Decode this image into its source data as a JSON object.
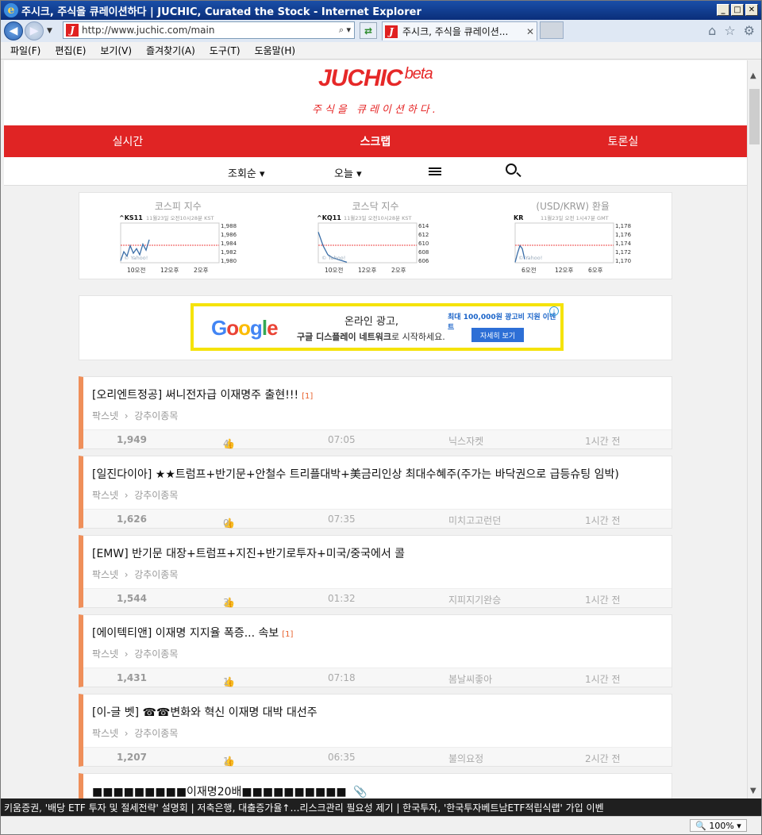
{
  "window": {
    "title": "주시크, 주식을 큐레이션하다 | JUCHIC, Curated the Stock - Internet Explorer"
  },
  "browser": {
    "url": "http://www.juchic.com/main",
    "tab_label": "주시크, 주식을 큐레이션...",
    "menu": [
      "파일(F)",
      "편집(E)",
      "보기(V)",
      "즐겨찾기(A)",
      "도구(T)",
      "도움말(H)"
    ],
    "zoom": "100%"
  },
  "site": {
    "logo": "JUCHIC",
    "logo_suffix": "beta",
    "tagline": "주식을 큐레이션하다.",
    "brand_color": "#e02424"
  },
  "main_nav": [
    "실시간",
    "스크랩",
    "토론실"
  ],
  "sub_nav": {
    "sort": "조회순",
    "period": "오늘"
  },
  "market": [
    {
      "title": "코스피 지수",
      "ticker": "^KS11",
      "stamp": "11월23일 오전10시28분 KST",
      "ticks": [
        "1,988",
        "1,986",
        "1,984",
        "1,982",
        "1,980"
      ],
      "xticks": [
        "10오전",
        "12오후",
        "2오후"
      ]
    },
    {
      "title": "코스닥 지수",
      "ticker": "^KQ11",
      "stamp": "11월23일 오전10시28분 KST",
      "ticks": [
        "614",
        "612",
        "610",
        "608",
        "606"
      ],
      "xticks": [
        "10오전",
        "12오후",
        "2오후"
      ]
    },
    {
      "title": "(USD/KRW) 환율",
      "ticker": "KR",
      "stamp": "11월23일 오전 1시47분 GMT",
      "ticks": [
        "1,178",
        "1,176",
        "1,174",
        "1,172",
        "1,170"
      ],
      "xticks": [
        "6오전",
        "12오후",
        "6오후"
      ]
    }
  ],
  "market_watermark": "© Yahoo!",
  "ad": {
    "brand": "Google",
    "line1": "온라인 광고,",
    "line2_bold": "구글 디스플레이 네트워크",
    "line2_rest": "로 시작하세요.",
    "promo": "최대 100,000원 광고비 지원 이벤트",
    "button": "자세히 보기"
  },
  "posts": [
    {
      "title": "[오리엔트정공] 써니전자급 이재명주 출현!!!",
      "count": "[1]",
      "source": "팍스넷",
      "category": "강추이종목",
      "views": "1,949",
      "likes": "4",
      "time": "07:05",
      "author": "닉스자켓",
      "ago": "1시간 전"
    },
    {
      "title": "[일진다이아] ★★트럼프+반기문+안철수 트리플대박+美금리인상 최대수혜주(주가는 바닥권으로 급등슈팅 임박)",
      "count": "",
      "source": "팍스넷",
      "category": "강추이종목",
      "views": "1,626",
      "likes": "0",
      "time": "07:35",
      "author": "미치고고런던",
      "ago": "1시간 전"
    },
    {
      "title": "[EMW] 반기문 대장+트럼프+지진+반기로투자+미국/중국에서 콜",
      "count": "",
      "source": "팍스넷",
      "category": "강추이종목",
      "views": "1,544",
      "likes": "3",
      "time": "01:32",
      "author": "지피지기완승",
      "ago": "1시간 전"
    },
    {
      "title": "[에이텍티앤] 이재명 지지율 폭증... 속보",
      "count": "[1]",
      "source": "팍스넷",
      "category": "강추이종목",
      "views": "1,431",
      "likes": "1",
      "time": "07:18",
      "author": "봄날씨좋아",
      "ago": "1시간 전"
    },
    {
      "title": "[이-글 벳] ☎☎변화와 혁신 이재명 대박 대선주",
      "count": "",
      "source": "팍스넷",
      "category": "강추이종목",
      "views": "1,207",
      "likes": "1",
      "time": "06:35",
      "author": "불의요정",
      "ago": "2시간 전"
    },
    {
      "title": "■■■■■■■■■이재명20배■■■■■■■■■■",
      "count": "",
      "source": "",
      "category": "",
      "views": "",
      "likes": "",
      "time": "",
      "author": "",
      "ago": ""
    }
  ],
  "ticker_text": "키움증권, '배당 ETF 투자 및 절세전략' 설명회  |  저축은행, 대출증가율↑…리스크관리 필요성 제기  |  한국투자, '한국투자베트남ETF적립식랩' 가입 이벤"
}
